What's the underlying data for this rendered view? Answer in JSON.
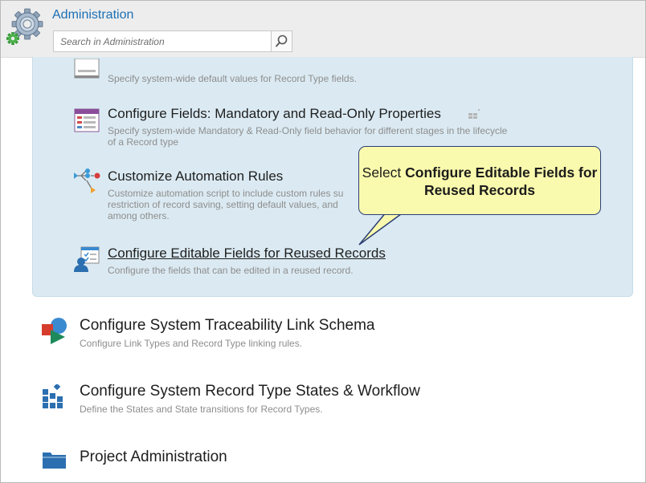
{
  "header": {
    "title": "Administration",
    "search_placeholder": "Search in Administration"
  },
  "panel_items": [
    {
      "title": "",
      "desc": "Specify system-wide default values for Record Type fields."
    },
    {
      "title": "Configure Fields: Mandatory and Read-Only Properties",
      "desc": "Specify system-wide Mandatory & Read-Only field behavior for different stages in the lifecycle of a Record type"
    },
    {
      "title": "Customize Automation Rules",
      "desc_line1": "Customize automation script to include custom rules su",
      "desc_line2": "restriction of record saving, setting default values, and",
      "desc_line3": "among others."
    },
    {
      "title": "Configure Editable Fields for Reused Records",
      "desc": "Configure the fields that can be edited in a reused record."
    }
  ],
  "callout": {
    "prefix": "Select ",
    "bold": "Configure Editable Fields for Reused Records"
  },
  "sections": [
    {
      "title": "Configure System Traceability Link Schema",
      "desc": "Configure Link Types and Record Type linking rules."
    },
    {
      "title": "Configure System Record Type States & Workflow",
      "desc": "Define the States and State transitions for Record Types."
    },
    {
      "title": "Project Administration"
    }
  ],
  "colors": {
    "accent": "#1b6fb5",
    "panel_bg": "#dbeaf2",
    "callout_bg": "#fafaae",
    "callout_border": "#2b3e75"
  }
}
